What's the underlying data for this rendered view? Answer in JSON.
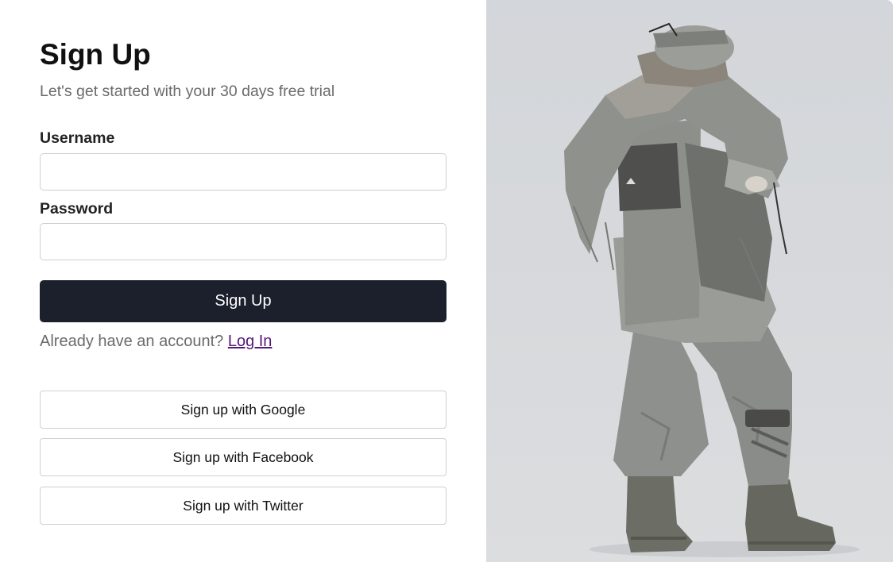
{
  "signup": {
    "title": "Sign Up",
    "subtitle": "Let's get started with your 30 days free trial",
    "username_label": "Username",
    "username_value": "",
    "password_label": "Password",
    "password_value": "",
    "submit_label": "Sign Up",
    "login_prompt": "Already have an account? ",
    "login_link_label": "Log In"
  },
  "social": {
    "google_label": "Sign up with Google",
    "facebook_label": "Sign up with Facebook",
    "twitter_label": "Sign up with Twitter"
  },
  "hero": {
    "image_subject": "model-in-techwear-outfit",
    "background_color": "#d4d7da"
  },
  "colors": {
    "primary_button": "#1b202c",
    "link": "#55187a",
    "muted_text": "#6b6b6b"
  }
}
